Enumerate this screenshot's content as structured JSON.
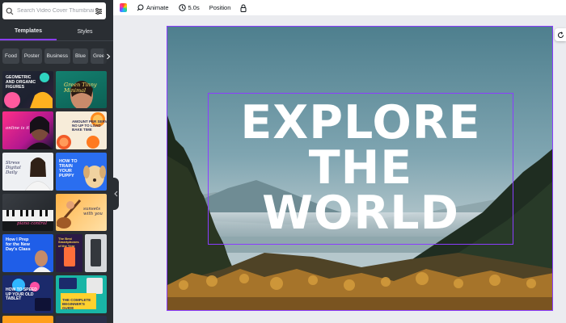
{
  "search": {
    "placeholder": "Search Video Cover Thumbnail tem",
    "icon": "search-icon",
    "filter_icon": "filter-icon"
  },
  "tabs": [
    {
      "label": "Templates",
      "active": true
    },
    {
      "label": "Styles",
      "active": false
    }
  ],
  "chips": [
    "Food",
    "Poster",
    "Business",
    "Blue",
    "Gree"
  ],
  "templates": [
    {
      "title": "GEOMETRIC\nAND ORGANIC\nFIGURES",
      "theme": "geometric"
    },
    {
      "title": "Green Tinny\nMinimal",
      "theme": "green-minimal"
    },
    {
      "title": "online is it",
      "theme": "pink-woman"
    },
    {
      "title": "AMOUNT PER SERVING\nNO UP TO LOAD\nBAKE TIME",
      "theme": "citrus"
    },
    {
      "title": "Stress\nDigital\nDaily",
      "theme": "woman-white"
    },
    {
      "title": "HOW TO\nTRAIN\nYOUR\nPUPPY",
      "theme": "puppy"
    },
    {
      "title": "piano control",
      "theme": "piano"
    },
    {
      "title": "sunsets\nwith you",
      "theme": "guitar"
    },
    {
      "title": "How I Prep\nfor the New\nDay's Class",
      "theme": "prep"
    },
    {
      "title": "The Best\nSmartphones\nof the Year",
      "theme": "smartphones"
    },
    {
      "title": "",
      "theme": "gray-device"
    },
    {
      "title": "HOW TO SPEED\nUP YOUR OLD\nTABLET",
      "theme": "tablet"
    },
    {
      "title": "THE COMPLETE\nBEGINNER'S\nGUIDE",
      "theme": "beginner"
    }
  ],
  "toolbar": {
    "color_icon": "color-palette",
    "animate_label": "Animate",
    "animate_icon": "animate-icon",
    "duration_label": "5.0s",
    "duration_icon": "clock-icon",
    "position_label": "Position",
    "lock_icon": "lock-icon"
  },
  "canvas": {
    "headline": "EXPLORE\nTHE\nWORLD",
    "background": "mountain-landscape",
    "selection_color": "#8b3dff",
    "rotate_icon": "rotate-icon"
  },
  "colors": {
    "panel": "#2a2e33",
    "accent": "#8b3dff",
    "workspace": "#ebecf0"
  }
}
